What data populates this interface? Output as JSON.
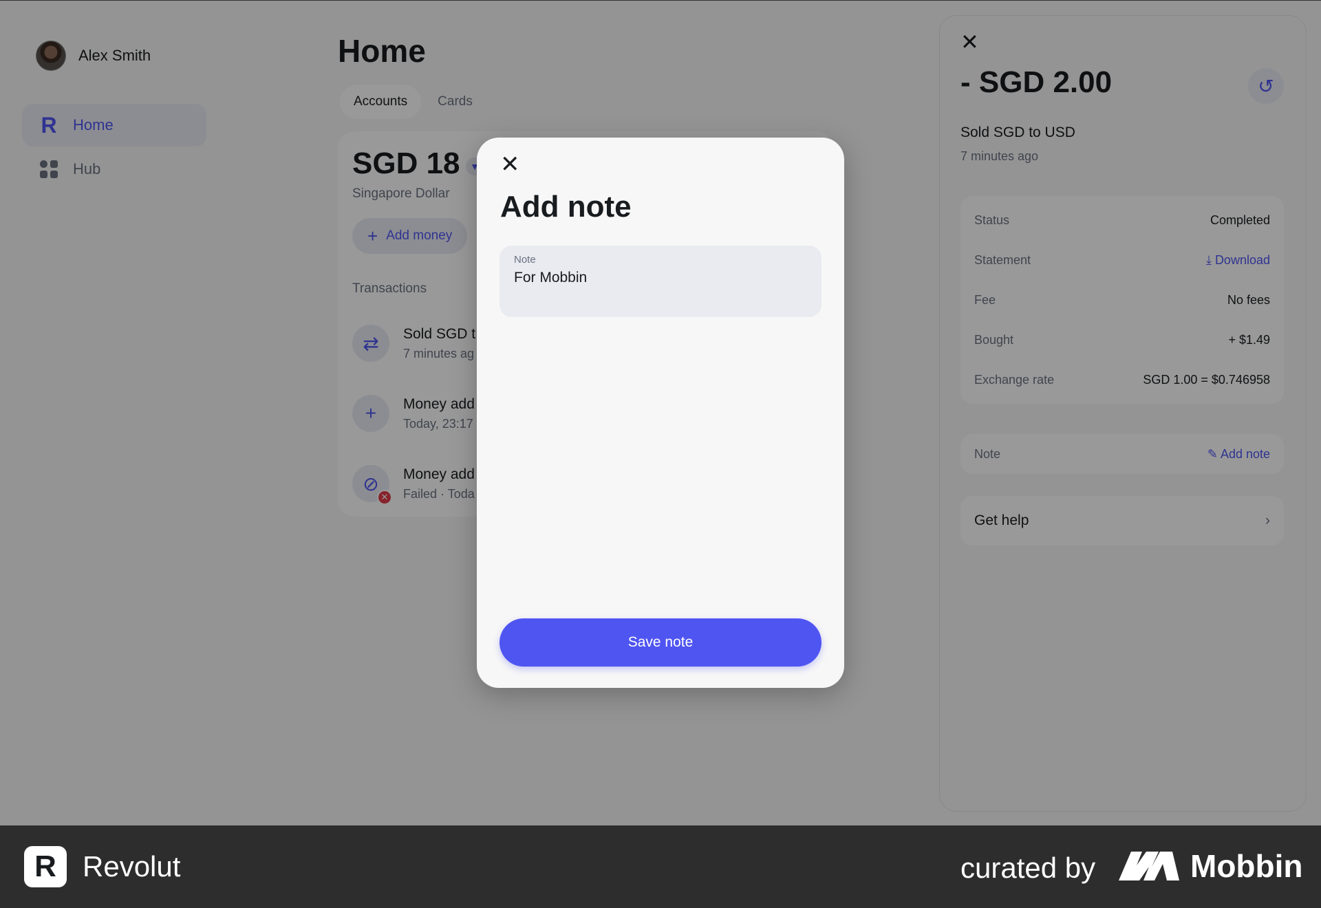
{
  "user": {
    "name": "Alex Smith"
  },
  "nav": {
    "items": [
      {
        "label": "Home",
        "icon": "revolut-r-icon"
      },
      {
        "label": "Hub",
        "icon": "grid-icon"
      }
    ]
  },
  "main": {
    "title": "Home",
    "tabs": [
      {
        "label": "Accounts"
      },
      {
        "label": "Cards"
      }
    ],
    "balance": "SGD 18",
    "currency": "Singapore Dollar",
    "add_money": "Add money",
    "transactions_label": "Transactions",
    "transactions": [
      {
        "title": "Sold SGD t",
        "sub": "7 minutes ag",
        "icon": "exchange-icon"
      },
      {
        "title": "Money add",
        "sub": "Today, 23:17",
        "icon": "plus-icon"
      },
      {
        "title": "Money add",
        "sub": "Failed · Toda",
        "icon": "blocked-icon"
      }
    ]
  },
  "panel": {
    "amount": "- SGD 2.00",
    "title": "Sold SGD to USD",
    "time": "7 minutes ago",
    "details": [
      {
        "key": "Status",
        "value": "Completed"
      },
      {
        "key": "Statement",
        "value": "Download"
      },
      {
        "key": "Fee",
        "value": "No fees"
      },
      {
        "key": "Bought",
        "value": "+ $1.49"
      },
      {
        "key": "Exchange rate",
        "value": "SGD 1.00 = $0.746958"
      }
    ],
    "note_label": "Note",
    "add_note": "Add note",
    "get_help": "Get help"
  },
  "modal": {
    "title": "Add note",
    "field_label": "Note",
    "field_value": "For Mobbin",
    "save_label": "Save note"
  },
  "footer": {
    "brand": "Revolut",
    "curated": "curated by",
    "mobbin": "Mobbin"
  },
  "colors": {
    "accent": "#4f55f1",
    "error": "#e23b4a",
    "footer_bg": "#2d2d2d"
  }
}
